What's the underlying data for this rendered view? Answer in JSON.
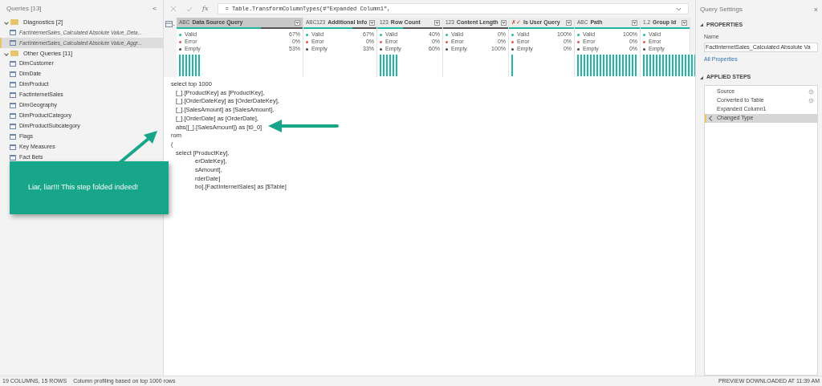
{
  "queries_panel": {
    "title": "Queries [13]",
    "collapse": "<",
    "groups": [
      {
        "label": "Diagnostics [2]",
        "expanded": true,
        "children": [
          {
            "label": "FactInternetSales_Calculated Absolute Value_Deta...",
            "kind": "diagnostic",
            "selected": false
          },
          {
            "label": "FactInternetSales_Calculated Absolute Value_Aggr...",
            "kind": "diagnostic",
            "selected": true
          }
        ]
      },
      {
        "label": "Other Queries [11]",
        "expanded": true,
        "children": [
          {
            "label": "DimCustomer",
            "kind": "query",
            "selected": false
          },
          {
            "label": "DimDate",
            "kind": "query",
            "selected": false
          },
          {
            "label": "DimProduct",
            "kind": "query",
            "selected": false
          },
          {
            "label": "FactInternetSales",
            "kind": "query",
            "selected": false
          },
          {
            "label": "DimGeography",
            "kind": "query",
            "selected": false
          },
          {
            "label": "DimProductCategory",
            "kind": "query",
            "selected": false
          },
          {
            "label": "DimProductSubcategory",
            "kind": "query",
            "selected": false
          },
          {
            "label": "Flags",
            "kind": "query",
            "selected": false
          },
          {
            "label": "Key Measures",
            "kind": "query",
            "selected": false
          },
          {
            "label": "Fact Bets",
            "kind": "query",
            "selected": false
          }
        ]
      }
    ]
  },
  "formula_bar": {
    "fx": "fx",
    "formula": "= Table.TransformColumnTypes(#\"Expanded Column1\","
  },
  "columns": [
    {
      "type_icon": "ABC",
      "name": "Data Source Query",
      "level": 0.67,
      "selected": true,
      "stats": [
        {
          "kind": "valid",
          "label": "Valid",
          "value": "67%"
        },
        {
          "kind": "error",
          "label": "Error",
          "value": "0%"
        },
        {
          "kind": "empty",
          "label": "Empty",
          "value": "53%"
        }
      ]
    },
    {
      "type_icon": "ABC123",
      "name": "Additional Info",
      "level": 0.67,
      "selected": false,
      "stats": [
        {
          "kind": "valid",
          "label": "Valid",
          "value": "67%"
        },
        {
          "kind": "error",
          "label": "Error",
          "value": "0%"
        },
        {
          "kind": "empty",
          "label": "Empty",
          "value": "33%"
        }
      ]
    },
    {
      "type_icon": "123",
      "name": "Row Count",
      "level": 0.4,
      "selected": false,
      "stats": [
        {
          "kind": "valid",
          "label": "Valid",
          "value": "40%"
        },
        {
          "kind": "error",
          "label": "Error",
          "value": "0%"
        },
        {
          "kind": "empty",
          "label": "Empty",
          "value": "60%"
        }
      ]
    },
    {
      "type_icon": "123",
      "name": "Content Length",
      "level": 0,
      "selected": false,
      "stats": [
        {
          "kind": "valid",
          "label": "Valid",
          "value": "0%"
        },
        {
          "kind": "error",
          "label": "Error",
          "value": "0%"
        },
        {
          "kind": "empty",
          "label": "Empty",
          "value": "100%"
        }
      ]
    },
    {
      "type_icon": "✗✓",
      "name": "Is User Query",
      "level": 1,
      "selected": false,
      "stats": [
        {
          "kind": "valid",
          "label": "Valid",
          "value": "100%"
        },
        {
          "kind": "error",
          "label": "Error",
          "value": "0%"
        },
        {
          "kind": "empty",
          "label": "Empty",
          "value": "0%"
        }
      ]
    },
    {
      "type_icon": "ABC",
      "name": "Path",
      "level": 1,
      "selected": false,
      "stats": [
        {
          "kind": "valid",
          "label": "Valid",
          "value": "100%"
        },
        {
          "kind": "error",
          "label": "Error",
          "value": "0%"
        },
        {
          "kind": "empty",
          "label": "Empty",
          "value": "0%"
        }
      ]
    },
    {
      "type_icon": "1.2",
      "name": "Group Id",
      "level": 1,
      "selected": false,
      "stats": [
        {
          "kind": "valid",
          "label": "Valid"
        },
        {
          "kind": "error",
          "label": "Error"
        },
        {
          "kind": "empty",
          "label": "Empty"
        }
      ]
    }
  ],
  "sql_lines": [
    {
      "text": "select top 1000",
      "kind": "top"
    },
    {
      "text": "[_].[ProductKey] as [ProductKey],",
      "kind": "inner"
    },
    {
      "text": "[_].[OrderDateKey] as [OrderDateKey],",
      "kind": "inner"
    },
    {
      "text": "[_].[SalesAmount] as [SalesAmount],",
      "kind": "inner"
    },
    {
      "text": "[_].[OrderDate] as [OrderDate],",
      "kind": "inner"
    },
    {
      "text": "abs([_].[SalesAmount]) as [t0_0]",
      "kind": "inner"
    },
    {
      "text": "rom",
      "kind": "top"
    },
    {
      "text": "(",
      "kind": "top"
    },
    {
      "text": "select [ProductKey],",
      "kind": "inner"
    },
    {
      "text": "erDateKey],",
      "kind": "covered"
    },
    {
      "text": "sAmount],",
      "kind": "covered"
    },
    {
      "text": "rderDate]",
      "kind": "covered"
    },
    {
      "text": "bo].[FactInternetSales] as [$Table]",
      "kind": "covered"
    }
  ],
  "callout": {
    "text": "Liar, liar!!! This step folded indeed!"
  },
  "query_settings": {
    "title": "Query Settings",
    "close": "×",
    "properties_heading": "PROPERTIES",
    "name_label": "Name",
    "name_value": "FactInternetSales_Calculated Absolute Va",
    "all_properties": "All Properties",
    "steps_heading": "APPLIED STEPS",
    "steps": [
      {
        "label": "Source",
        "has_settings": true,
        "selected": false
      },
      {
        "label": "Converted to Table",
        "has_settings": true,
        "selected": false
      },
      {
        "label": "Expanded Column1",
        "has_settings": false,
        "selected": false
      },
      {
        "label": "Changed Type",
        "has_settings": false,
        "selected": true
      }
    ]
  },
  "status_bar": {
    "counts": "19 COLUMNS, 15 ROWS",
    "profiling": "Column profiling based on top 1000 rows",
    "preview": "PREVIEW DOWNLOADED AT 11:39 AM"
  }
}
